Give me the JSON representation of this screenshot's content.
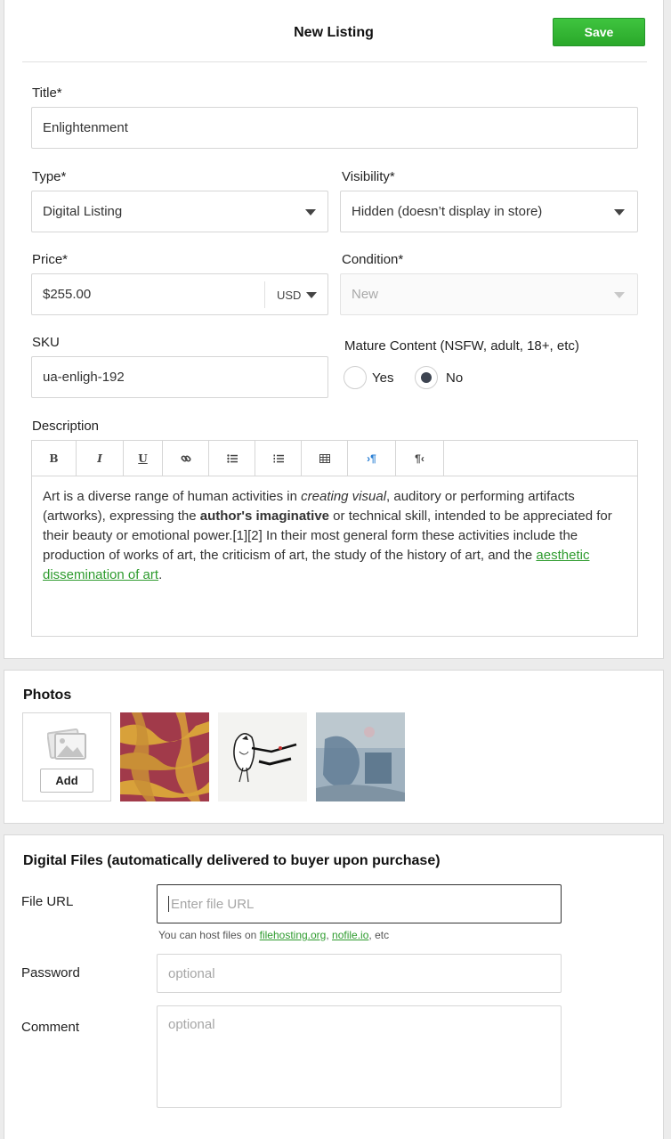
{
  "header": {
    "title": "New Listing",
    "save_label": "Save"
  },
  "listing": {
    "title_label": "Title*",
    "title_value": "Enlightenment",
    "type_label": "Type*",
    "type_value": "Digital Listing",
    "visibility_label": "Visibility*",
    "visibility_value": "Hidden (doesn’t display in store)",
    "price_label": "Price*",
    "price_value": "$255.00",
    "currency_value": "USD",
    "condition_label": "Condition*",
    "condition_value": "New",
    "sku_label": "SKU",
    "sku_value": "ua-enligh-192",
    "mature_label": "Mature Content (NSFW, adult, 18+, etc)",
    "mature_options": [
      {
        "label": "Yes",
        "selected": false
      },
      {
        "label": "No",
        "selected": true
      }
    ],
    "description_label": "Description"
  },
  "editor": {
    "toolbar": [
      {
        "icon": "bold-icon",
        "glyph": "B"
      },
      {
        "icon": "italic-icon",
        "glyph": "I"
      },
      {
        "icon": "underline-icon",
        "glyph": "U"
      },
      {
        "icon": "link-icon",
        "glyph": "☲"
      },
      {
        "icon": "bullet-list-icon",
        "glyph": "☰"
      },
      {
        "icon": "numbered-list-icon",
        "glyph": "☰"
      },
      {
        "icon": "table-icon",
        "glyph": "▦"
      },
      {
        "icon": "ltr-icon",
        "glyph": "›¶"
      },
      {
        "icon": "rtl-icon",
        "glyph": "¶‹"
      }
    ],
    "content": {
      "p1": "Art is a diverse range of human activities in ",
      "em": "creating visual",
      "p2": ", auditory or performing artifacts (artworks), expressing the ",
      "strong": "author's imaginative",
      "p3": " or technical skill, intended to be appreciated for their beauty or emotional power.[1][2] In their most general form these activities include the production of works of art, the criticism of art, the study of the history of art, and the ",
      "link": "aesthetic dissemination of art",
      "p4": "."
    },
    "accent_color": "#2e9b2e"
  },
  "photos": {
    "title": "Photos",
    "add_label": "Add",
    "thumbnails": [
      "abstract-orange-pattern",
      "bird-ink-sketch",
      "blue-grey-abstract"
    ]
  },
  "files": {
    "title": "Digital Files (automatically delivered to buyer upon purchase)",
    "file_url_label": "File URL",
    "file_url_placeholder": "Enter file URL",
    "hint_prefix": "You can host files on ",
    "hint_link1": "filehosting.org",
    "hint_sep": ", ",
    "hint_link2": "nofile.io",
    "hint_suffix": ", etc",
    "password_label": "Password",
    "password_placeholder": "optional",
    "comment_label": "Comment",
    "comment_placeholder": "optional"
  },
  "colors": {
    "save_green": "#2aa82a",
    "link_green": "#2e9b2e",
    "radio_selected": "#3d4451"
  }
}
